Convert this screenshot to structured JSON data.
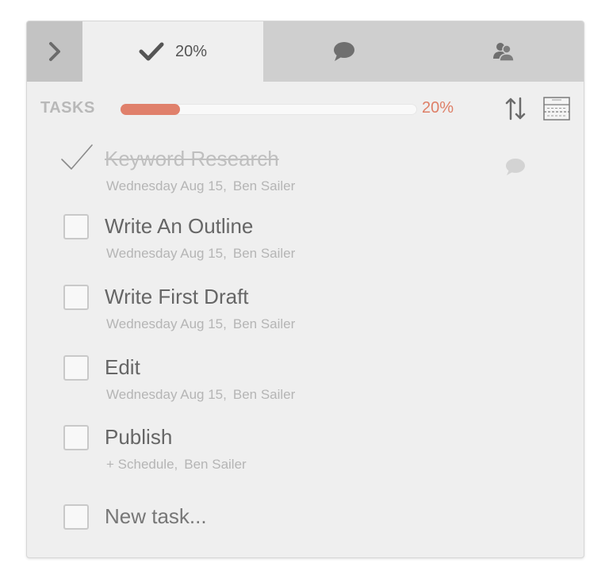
{
  "tabs": {
    "tasks_progress": "20%"
  },
  "section": {
    "title": "TASKS",
    "progress_fraction": 0.2,
    "progress_label": "20%"
  },
  "tasks": [
    {
      "title": "Keyword Research",
      "date": "Wednesday Aug 15,",
      "assignee": "Ben Sailer",
      "done": true
    },
    {
      "title": "Write An Outline",
      "date": "Wednesday Aug 15,",
      "assignee": "Ben Sailer",
      "done": false
    },
    {
      "title": "Write First Draft",
      "date": "Wednesday Aug 15,",
      "assignee": "Ben Sailer",
      "done": false
    },
    {
      "title": "Edit",
      "date": "Wednesday Aug 15,",
      "assignee": "Ben Sailer",
      "done": false
    },
    {
      "title": "Publish",
      "date": "+ Schedule,",
      "assignee": "Ben Sailer",
      "done": false
    }
  ],
  "new_task": {
    "label": "New task..."
  },
  "icons": {
    "collapse": "chevron-right-icon",
    "tasks_tab": "checkmark-icon",
    "comments_tab": "speech-bubble-icon",
    "people_tab": "people-icon",
    "sort": "sort-arrows-icon",
    "layout": "layout-grid-icon"
  },
  "colors": {
    "accent": "#e0806b",
    "panel_bg": "#efefef",
    "tab_bar": "#cfcfcf"
  }
}
